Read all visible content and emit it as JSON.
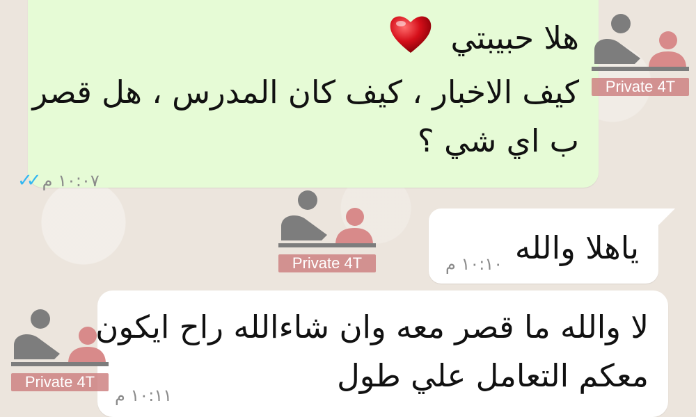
{
  "chat": {
    "outgoing": {
      "lines": [
        "هلا حبيبتي",
        "كيف الاخبار ، كيف كان المدرس ، هل قصر",
        "ب اي شي ؟"
      ],
      "time": "١٠:٠٧ م",
      "status_icon": "double-check-read-icon",
      "tick_color": "#34b7f1"
    },
    "incoming": [
      {
        "lines": [
          "ياهلا والله"
        ],
        "time": "١٠:١٠ م"
      },
      {
        "lines": [
          "لا والله ما قصر معه وان شاءالله راح ايكون",
          "معكم التعامل علي طول"
        ],
        "time": "١٠:١١ م"
      }
    ]
  },
  "watermark": {
    "label": "Private 4T",
    "icon": "private-tutor-logo-icon"
  },
  "colors": {
    "outgoing_bubble": "#e6fbd6",
    "incoming_bubble": "#ffffff",
    "background": "#ece5dd"
  }
}
